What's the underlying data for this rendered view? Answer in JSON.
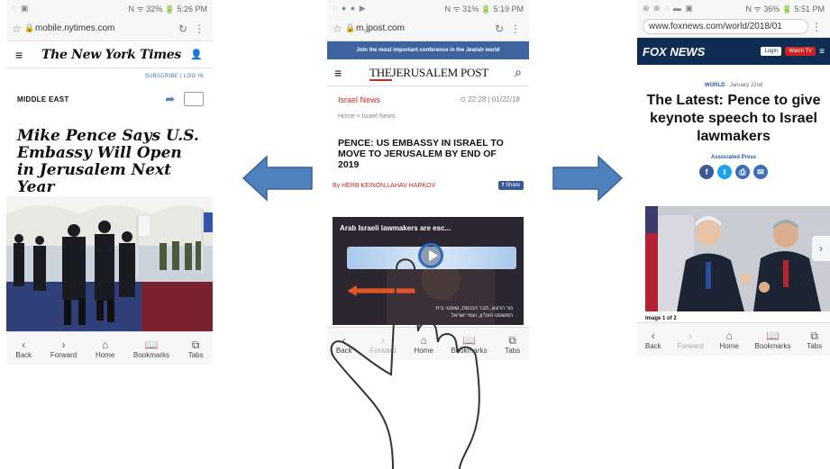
{
  "nyt": {
    "status": {
      "left": "◌ ▣",
      "right": "N ᯤ 32% 🔋 5:26 PM"
    },
    "url": "mobile.nytimes.com",
    "logo": "The New York Times",
    "links": "SUBSCRIBE  |  LOG IN",
    "section": "MIDDLE EAST",
    "headline": "Mike Pence Says U.S. Embassy Will Open in Jerusalem Next Year"
  },
  "jpost": {
    "status": {
      "left": "◌ ● ● ▶",
      "right": "N ᯤ 31% 🔋 5:19 PM"
    },
    "url": "m.jpost.com",
    "banner": "Join the most important conference in the Jewish world",
    "logo_prefix": "THE",
    "logo_main": "JERUSALEM POST",
    "section": "Israel News",
    "time": "⊙ 22:28 | 01/22/18",
    "breadcrumb": "Home  >  Israel News",
    "title": "PENCE: US EMBASSY IN ISRAEL TO MOVE TO JERUSALEM BY END OF 2019",
    "byline": "By HERB KEINON,LAHAV HARKOV",
    "share": "Share",
    "video_title": "Arab Israeli lawmakers are esc...",
    "video_sub1": "מר הרצוג, חבר הכנסת, שופטי בית",
    "video_sub2": "המשפט העליון, ועמי ישראל"
  },
  "fox": {
    "status": {
      "left": "⊕ ⊕ ◌ ▬ ▣",
      "right": "N ᯤ 36% 🔋 5:51 PM"
    },
    "url": "www.foxnews.com/world/2018/01",
    "logo": "FOX NEWS",
    "login": "Login",
    "watch": "Watch TV",
    "world": "WORLD",
    "date": " · January 22nd",
    "title": "The Latest: Pence to give keynote speech to Israel lawmakers",
    "source": "Associated Press",
    "caption": "Image 1 of 2"
  },
  "browser_nav": {
    "back": "Back",
    "forward": "Forward",
    "home": "Home",
    "bookmarks": "Bookmarks",
    "tabs": "Tabs"
  },
  "colors": {
    "fox_blue": "#0f2d52",
    "jpost_red": "#c42a2a",
    "arrow_blue": "#4f81bd"
  }
}
